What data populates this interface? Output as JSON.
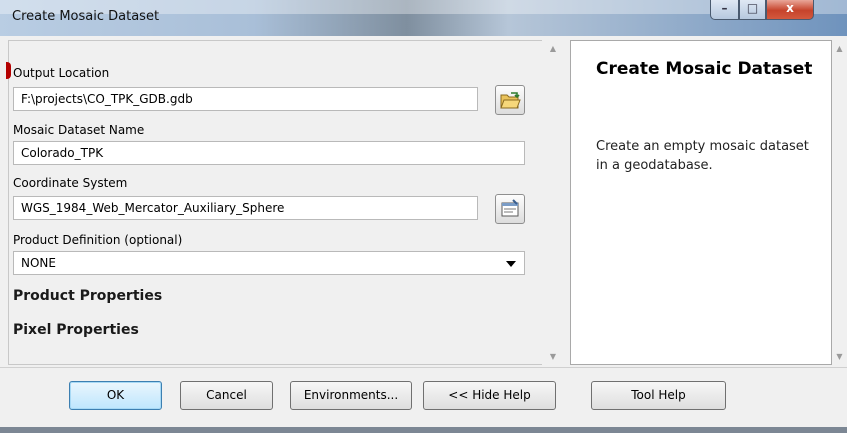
{
  "window": {
    "title": "Create Mosaic Dataset",
    "controls": {
      "minimize": "–",
      "maximize": "□",
      "close": "x"
    }
  },
  "form": {
    "output_location": {
      "label": "Output Location",
      "value": "F:\\projects\\CO_TPK_GDB.gdb",
      "icon": "folder-open-icon"
    },
    "mosaic_dataset_name": {
      "label": "Mosaic Dataset Name",
      "value": "Colorado_TPK"
    },
    "coordinate_system": {
      "label": "Coordinate System",
      "value": "WGS_1984_Web_Mercator_Auxiliary_Sphere",
      "icon": "properties-icon"
    },
    "product_definition": {
      "label": "Product Definition (optional)",
      "value": "NONE"
    },
    "sections": {
      "product_properties": "Product Properties",
      "pixel_properties": "Pixel Properties"
    }
  },
  "help_panel": {
    "title": "Create Mosaic Dataset",
    "description": "Create an empty mosaic dataset in a geodatabase."
  },
  "buttons": {
    "ok": "OK",
    "cancel": "Cancel",
    "environments": "Environments...",
    "hide_help": "<< Hide Help",
    "tool_help": "Tool Help"
  },
  "colors": {
    "warning_marker": "#b40000",
    "close_button": "#c6432b"
  }
}
